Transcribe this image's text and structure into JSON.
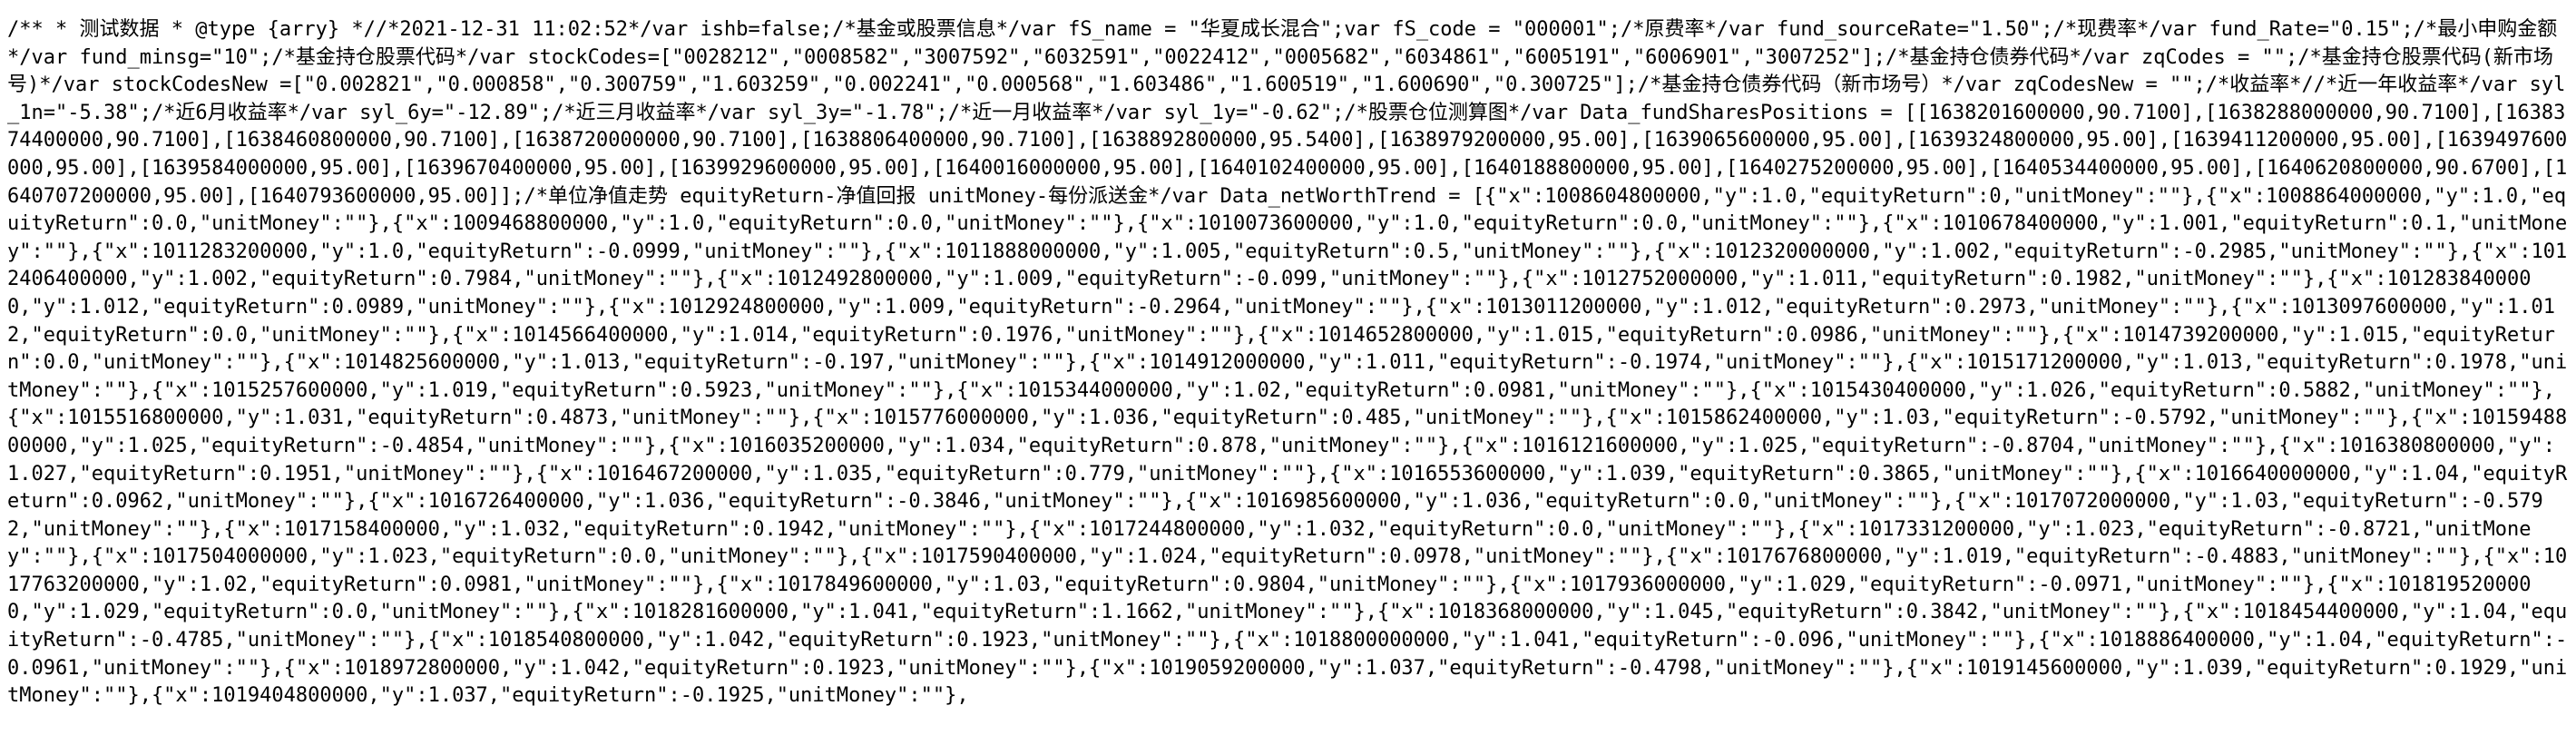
{
  "document": {
    "text": "/** * 测试数据 * @type {arry} *//*2021-12-31 11:02:52*/var ishb=false;/*基金或股票信息*/var fS_name = \"华夏成长混合\";var fS_code = \"000001\";/*原费率*/var fund_sourceRate=\"1.50\";/*现费率*/var fund_Rate=\"0.15\";/*最小申购金额*/var fund_minsg=\"10\";/*基金持仓股票代码*/var stockCodes=[\"0028212\",\"0008582\",\"3007592\",\"6032591\",\"0022412\",\"0005682\",\"6034861\",\"6005191\",\"6006901\",\"3007252\"];/*基金持仓债券代码*/var zqCodes = \"\";/*基金持仓股票代码(新市场号)*/var stockCodesNew =[\"0.002821\",\"0.000858\",\"0.300759\",\"1.603259\",\"0.002241\",\"0.000568\",\"1.603486\",\"1.600519\",\"1.600690\",\"0.300725\"];/*基金持仓债券代码（新市场号）*/var zqCodesNew = \"\";/*收益率*//*近一年收益率*/var syl_1n=\"-5.38\";/*近6月收益率*/var syl_6y=\"-12.89\";/*近三月收益率*/var syl_3y=\"-1.78\";/*近一月收益率*/var syl_1y=\"-0.62\";/*股票仓位测算图*/var Data_fundSharesPositions = [[1638201600000,90.7100],[1638288000000,90.7100],[1638374400000,90.7100],[1638460800000,90.7100],[1638720000000,90.7100],[1638806400000,90.7100],[1638892800000,95.5400],[1638979200000,95.00],[1639065600000,95.00],[1639324800000,95.00],[1639411200000,95.00],[1639497600000,95.00],[1639584000000,95.00],[1639670400000,95.00],[1639929600000,95.00],[1640016000000,95.00],[1640102400000,95.00],[1640188800000,95.00],[1640275200000,95.00],[1640534400000,95.00],[1640620800000,90.6700],[1640707200000,95.00],[1640793600000,95.00]];/*单位净值走势 equityReturn-净值回报 unitMoney-每份派送金*/var Data_netWorthTrend = [{\"x\":1008604800000,\"y\":1.0,\"equityReturn\":0,\"unitMoney\":\"\"},{\"x\":1008864000000,\"y\":1.0,\"equityReturn\":0.0,\"unitMoney\":\"\"},{\"x\":1009468800000,\"y\":1.0,\"equityReturn\":0.0,\"unitMoney\":\"\"},{\"x\":1010073600000,\"y\":1.0,\"equityReturn\":0.0,\"unitMoney\":\"\"},{\"x\":1010678400000,\"y\":1.001,\"equityReturn\":0.1,\"unitMoney\":\"\"},{\"x\":1011283200000,\"y\":1.0,\"equityReturn\":-0.0999,\"unitMoney\":\"\"},{\"x\":1011888000000,\"y\":1.005,\"equityReturn\":0.5,\"unitMoney\":\"\"},{\"x\":1012320000000,\"y\":1.002,\"equityReturn\":-0.2985,\"unitMoney\":\"\"},{\"x\":1012406400000,\"y\":1.002,\"equityReturn\":0.7984,\"unitMoney\":\"\"},{\"x\":1012492800000,\"y\":1.009,\"equityReturn\":-0.099,\"unitMoney\":\"\"},{\"x\":1012752000000,\"y\":1.011,\"equityReturn\":0.1982,\"unitMoney\":\"\"},{\"x\":1012838400000,\"y\":1.012,\"equityReturn\":0.0989,\"unitMoney\":\"\"},{\"x\":1012924800000,\"y\":1.009,\"equityReturn\":-0.2964,\"unitMoney\":\"\"},{\"x\":1013011200000,\"y\":1.012,\"equityReturn\":0.2973,\"unitMoney\":\"\"},{\"x\":1013097600000,\"y\":1.012,\"equityReturn\":0.0,\"unitMoney\":\"\"},{\"x\":1014566400000,\"y\":1.014,\"equityReturn\":0.1976,\"unitMoney\":\"\"},{\"x\":1014652800000,\"y\":1.015,\"equityReturn\":0.0986,\"unitMoney\":\"\"},{\"x\":1014739200000,\"y\":1.015,\"equityReturn\":0.0,\"unitMoney\":\"\"},{\"x\":1014825600000,\"y\":1.013,\"equityReturn\":-0.197,\"unitMoney\":\"\"},{\"x\":1014912000000,\"y\":1.011,\"equityReturn\":-0.1974,\"unitMoney\":\"\"},{\"x\":1015171200000,\"y\":1.013,\"equityReturn\":0.1978,\"unitMoney\":\"\"},{\"x\":1015257600000,\"y\":1.019,\"equityReturn\":0.5923,\"unitMoney\":\"\"},{\"x\":1015344000000,\"y\":1.02,\"equityReturn\":0.0981,\"unitMoney\":\"\"},{\"x\":1015430400000,\"y\":1.026,\"equityReturn\":0.5882,\"unitMoney\":\"\"},{\"x\":1015516800000,\"y\":1.031,\"equityReturn\":0.4873,\"unitMoney\":\"\"},{\"x\":1015776000000,\"y\":1.036,\"equityReturn\":0.485,\"unitMoney\":\"\"},{\"x\":1015862400000,\"y\":1.03,\"equityReturn\":-0.5792,\"unitMoney\":\"\"},{\"x\":1015948800000,\"y\":1.025,\"equityReturn\":-0.4854,\"unitMoney\":\"\"},{\"x\":1016035200000,\"y\":1.034,\"equityReturn\":0.878,\"unitMoney\":\"\"},{\"x\":1016121600000,\"y\":1.025,\"equityReturn\":-0.8704,\"unitMoney\":\"\"},{\"x\":1016380800000,\"y\":1.027,\"equityReturn\":0.1951,\"unitMoney\":\"\"},{\"x\":1016467200000,\"y\":1.035,\"equityReturn\":0.779,\"unitMoney\":\"\"},{\"x\":1016553600000,\"y\":1.039,\"equityReturn\":0.3865,\"unitMoney\":\"\"},{\"x\":1016640000000,\"y\":1.04,\"equityReturn\":0.0962,\"unitMoney\":\"\"},{\"x\":1016726400000,\"y\":1.036,\"equityReturn\":-0.3846,\"unitMoney\":\"\"},{\"x\":1016985600000,\"y\":1.036,\"equityReturn\":0.0,\"unitMoney\":\"\"},{\"x\":1017072000000,\"y\":1.03,\"equityReturn\":-0.5792,\"unitMoney\":\"\"},{\"x\":1017158400000,\"y\":1.032,\"equityReturn\":0.1942,\"unitMoney\":\"\"},{\"x\":1017244800000,\"y\":1.032,\"equityReturn\":0.0,\"unitMoney\":\"\"},{\"x\":1017331200000,\"y\":1.023,\"equityReturn\":-0.8721,\"unitMoney\":\"\"},{\"x\":1017504000000,\"y\":1.023,\"equityReturn\":0.0,\"unitMoney\":\"\"},{\"x\":1017590400000,\"y\":1.024,\"equityReturn\":0.0978,\"unitMoney\":\"\"},{\"x\":1017676800000,\"y\":1.019,\"equityReturn\":-0.4883,\"unitMoney\":\"\"},{\"x\":1017763200000,\"y\":1.02,\"equityReturn\":0.0981,\"unitMoney\":\"\"},{\"x\":1017849600000,\"y\":1.03,\"equityReturn\":0.9804,\"unitMoney\":\"\"},{\"x\":1017936000000,\"y\":1.029,\"equityReturn\":-0.0971,\"unitMoney\":\"\"},{\"x\":1018195200000,\"y\":1.029,\"equityReturn\":0.0,\"unitMoney\":\"\"},{\"x\":1018281600000,\"y\":1.041,\"equityReturn\":1.1662,\"unitMoney\":\"\"},{\"x\":1018368000000,\"y\":1.045,\"equityReturn\":0.3842,\"unitMoney\":\"\"},{\"x\":1018454400000,\"y\":1.04,\"equityReturn\":-0.4785,\"unitMoney\":\"\"},{\"x\":1018540800000,\"y\":1.042,\"equityReturn\":0.1923,\"unitMoney\":\"\"},{\"x\":1018800000000,\"y\":1.041,\"equityReturn\":-0.096,\"unitMoney\":\"\"},{\"x\":1018886400000,\"y\":1.04,\"equityReturn\":-0.0961,\"unitMoney\":\"\"},{\"x\":1018972800000,\"y\":1.042,\"equityReturn\":0.1923,\"unitMoney\":\"\"},{\"x\":1019059200000,\"y\":1.037,\"equityReturn\":-0.4798,\"unitMoney\":\"\"},{\"x\":1019145600000,\"y\":1.039,\"equityReturn\":0.1929,\"unitMoney\":\"\"},{\"x\":1019404800000,\"y\":1.037,\"equityReturn\":-0.1925,\"unitMoney\":\"\"},"
  }
}
